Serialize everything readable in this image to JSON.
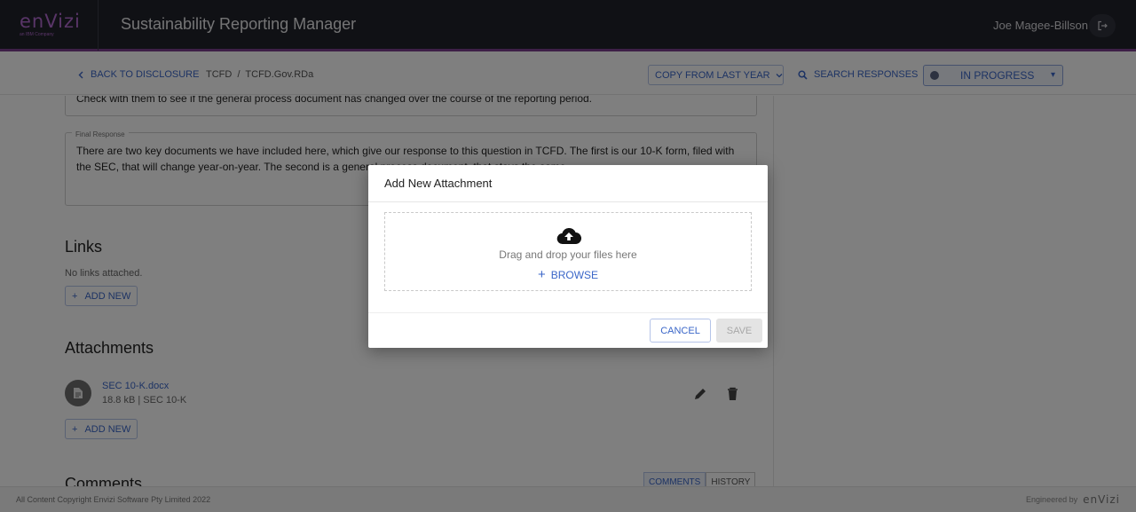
{
  "header": {
    "logo_text": "enVizi",
    "logo_sub": "an IBM Company",
    "app_title": "Sustainability Reporting Manager",
    "user_name": "Joe Magee-Billson",
    "logout_icon": "logout-icon"
  },
  "subbar": {
    "back_label": "BACK TO DISCLOSURE",
    "breadcrumb": "TCFD  /  TCFD.Gov.RDa",
    "copy_label": "COPY FROM LAST YEAR",
    "search_label": "SEARCH RESPONSES",
    "status_label": "IN PROGRESS"
  },
  "content": {
    "previous_text": "Check with them to see if the general process document has changed over the course of the reporting period.",
    "final_legend": "Final Response",
    "final_text": "There are two key documents we have included here, which give our response to this question in TCFD. The first is our 10-K form, filed with the SEC, that will change year-on-year. The second is a general process document, that stays the same.",
    "links_title": "Links",
    "links_empty": "No links attached.",
    "add_new_label": "ADD NEW",
    "attachments_title": "Attachments",
    "attachment": {
      "name": "SEC 10-K.docx",
      "meta": "18.8 kB | SEC 10-K"
    },
    "comments_title": "Comments",
    "tabs": [
      "COMMENTS",
      "HISTORY"
    ]
  },
  "footer": {
    "copyright": "All Content Copyright Envizi Software Pty Limited 2022",
    "engineered_by": "Engineered by",
    "engineered_logo": "enVizi"
  },
  "modal": {
    "title": "Add New Attachment",
    "drop_text": "Drag and drop your files here",
    "browse_label": "BROWSE",
    "cancel_label": "CANCEL",
    "save_label": "SAVE"
  }
}
